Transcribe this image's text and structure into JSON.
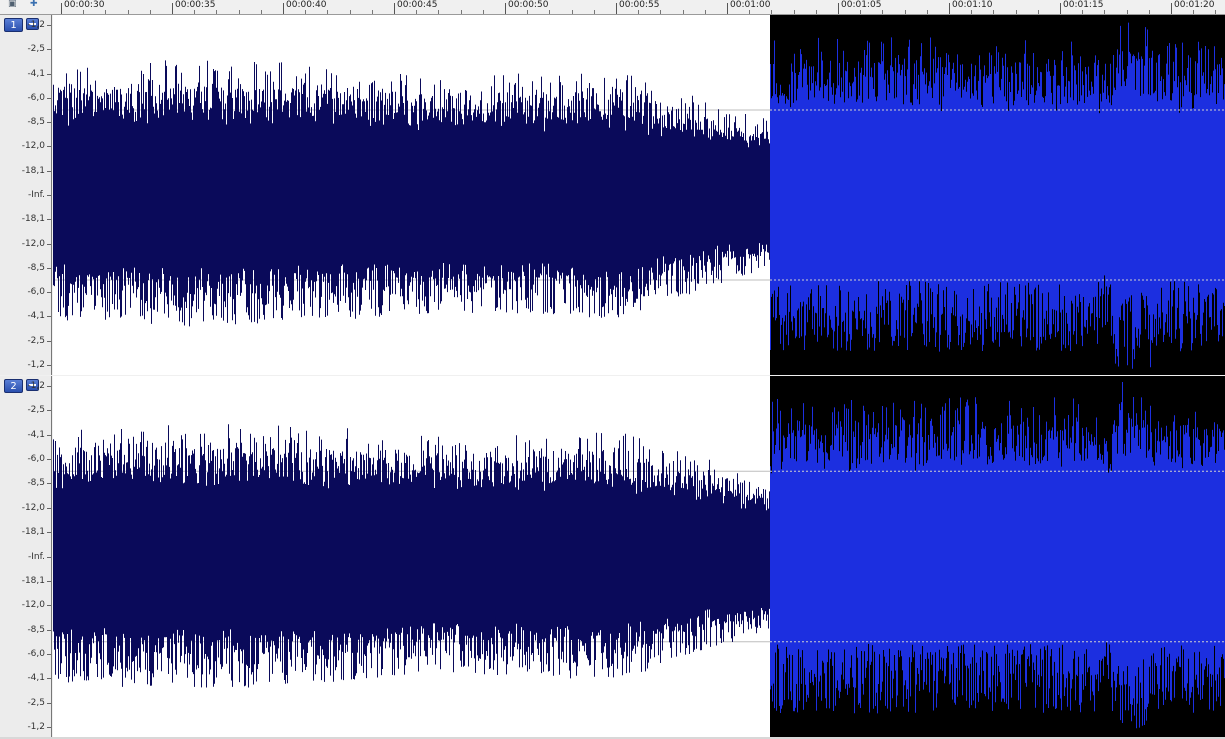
{
  "ruler": {
    "time_labels": [
      "00:00:30",
      "00:00:35",
      "00:00:40",
      "00:00:45",
      "00:00:50",
      "00:00:55",
      "00:01:00",
      "00:01:05",
      "00:01:10",
      "00:01:15",
      "00:01:20"
    ]
  },
  "channels": [
    {
      "label": "1",
      "db_scale": [
        "-1,2",
        "-2,5",
        "-4,1",
        "-6,0",
        "-8,5",
        "-12,0",
        "-18,1",
        "-Inf.",
        "-18,1",
        "-12,0",
        "-8,5",
        "-6,0",
        "-4,1",
        "-2,5",
        "-1,2"
      ]
    },
    {
      "label": "2",
      "db_scale": [
        "-1,2",
        "-2,5",
        "-4,1",
        "-6,0",
        "-8,5",
        "-12,0",
        "-18,1",
        "-Inf.",
        "-18,1",
        "-12,0",
        "-8,5",
        "-6,0",
        "-4,1",
        "-2,5",
        "-1,2"
      ]
    }
  ],
  "colors": {
    "unselected_background": "#ffffff",
    "unselected_wave": "#0a0a5a",
    "selected_background": "#000000",
    "selected_wave": "#1c2fe0",
    "guide_line_unselected": "#bdbdbd",
    "guide_line_selected": "#cfcfcf"
  },
  "icons": [
    "lock-icon",
    "cursor-tool-icon"
  ]
}
